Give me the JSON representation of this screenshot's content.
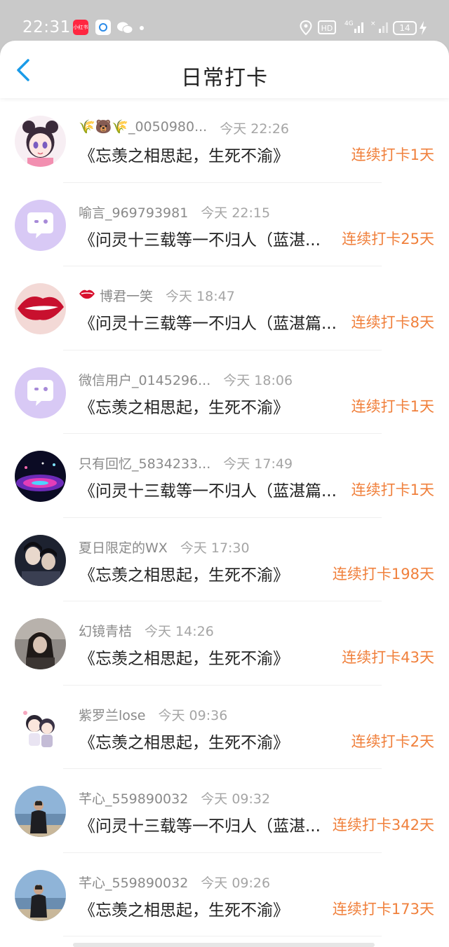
{
  "status_bar": {
    "time": "22:31",
    "left_icons": [
      "xiaohongshu-icon",
      "browser-icon",
      "wechat-icon",
      "dot-icon"
    ],
    "right_icons": [
      "location-icon",
      "hd-icon",
      "signal-4g-icon",
      "signal-icon",
      "battery-icon",
      "charging-icon"
    ],
    "battery": "14"
  },
  "nav": {
    "title": "日常打卡",
    "back_icon": "chevron-left-icon"
  },
  "colors": {
    "streak": "#f0803c",
    "back_icon": "#1a9be8",
    "status_bar": "#c9c9c9"
  },
  "checkins": [
    {
      "user": "🌾🐻🌾_0050980...",
      "time": "今天 22:26",
      "post": "《忘羡之相思起，生死不渝》",
      "streak": "连续打卡1天",
      "avatar": "anime-girl-avatar"
    },
    {
      "user": "喻言_969793981",
      "time": "今天 22:15",
      "post": "《问灵十三载等一不归人（蓝湛...",
      "streak": "连续打卡25天",
      "avatar": "default-chat-avatar"
    },
    {
      "user": "博君一笑",
      "time": "今天 18:47",
      "post": "《问灵十三载等一不归人（蓝湛篇...",
      "streak": "连续打卡8天",
      "avatar": "lips-avatar",
      "prefix_icon": "lips-icon"
    },
    {
      "user": "微信用户_0145296...",
      "time": "今天 18:06",
      "post": "《忘羡之相思起，生死不渝》",
      "streak": "连续打卡1天",
      "avatar": "default-chat-avatar"
    },
    {
      "user": "只有回忆_5834233...",
      "time": "今天 17:49",
      "post": "《问灵十三载等一不归人（蓝湛篇...",
      "streak": "连续打卡1天",
      "avatar": "night-lights-avatar"
    },
    {
      "user": "夏日限定的WX",
      "time": "今天 17:30",
      "post": "《忘羡之相思起，生死不渝》",
      "streak": "连续打卡198天",
      "avatar": "drama-still-avatar"
    },
    {
      "user": "幻镜青桔",
      "time": "今天 14:26",
      "post": "《忘羡之相思起，生死不渝》",
      "streak": "连续打卡43天",
      "avatar": "selfie-avatar"
    },
    {
      "user": "紫罗兰lose",
      "time": "今天 09:36",
      "post": "《忘羡之相思起，生死不渝》",
      "streak": "连续打卡2天",
      "avatar": "chibi-couple-avatar"
    },
    {
      "user": "芊心_559890032",
      "time": "今天 09:32",
      "post": "《问灵十三载等一不归人（蓝湛...",
      "streak": "连续打卡342天",
      "avatar": "seaside-person-avatar"
    },
    {
      "user": "芊心_559890032",
      "time": "今天 09:26",
      "post": "《忘羡之相思起，生死不渝》",
      "streak": "连续打卡173天",
      "avatar": "seaside-person-avatar"
    }
  ]
}
